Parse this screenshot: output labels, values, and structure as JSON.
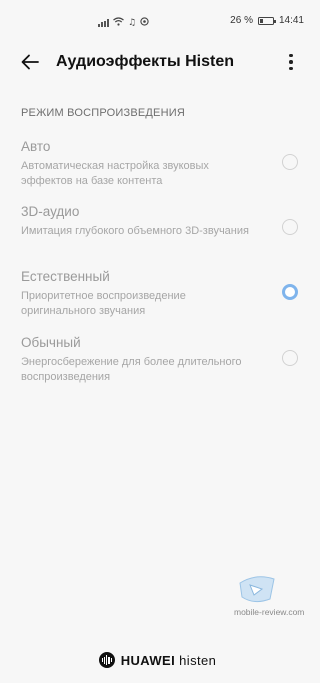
{
  "status_bar": {
    "battery_percent": "26 %",
    "time": "14:41"
  },
  "header": {
    "title": "Аудиоэффекты Histen"
  },
  "section": {
    "title": "РЕЖИМ ВОСПРОИЗВЕДЕНИЯ"
  },
  "options": [
    {
      "title": "Авто",
      "description": "Автоматическая настройка звуковых эффектов на базе контента",
      "selected": false
    },
    {
      "title": "3D-аудио",
      "description": "Имитация глубокого объемного 3D-звучания",
      "selected": false
    },
    {
      "title": "Естественный",
      "description": "Приоритетное воспроизведение оригинального звучания",
      "selected": true
    },
    {
      "title": "Обычный",
      "description": "Энергосбережение для более длительного воспроизведения",
      "selected": false
    }
  ],
  "watermark": {
    "text": "mobile-review.com"
  },
  "footer": {
    "brand_bold": "HUAWEI",
    "brand_light": "histen"
  },
  "colors": {
    "accent_radio": "#7fb4ec",
    "background": "#f7f7f7"
  }
}
